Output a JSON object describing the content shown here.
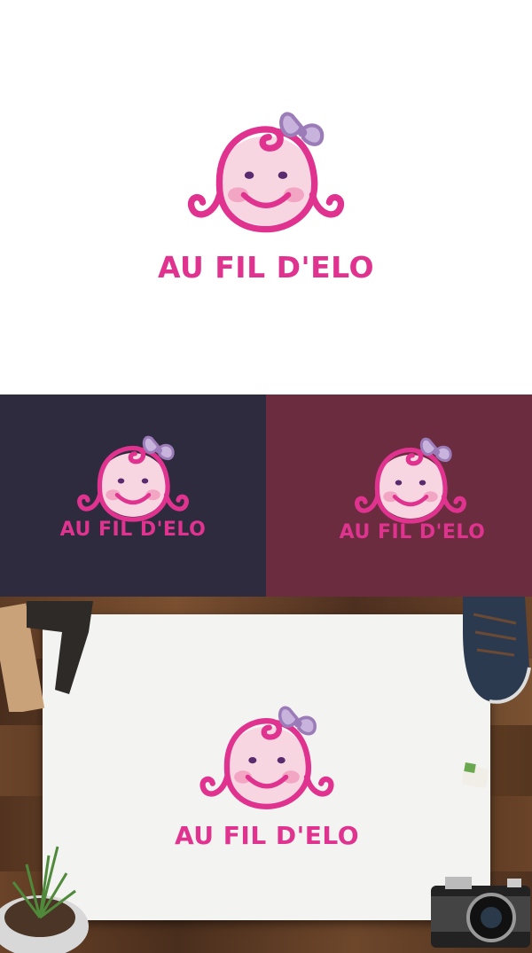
{
  "brand": {
    "name": "AU FIL D'ELO"
  },
  "colors": {
    "magenta": "#e0338f",
    "light_magenta": "#f06aa8",
    "face": "#f7d6e2",
    "cheek": "#f3a6c4",
    "bow": "#9b7cb8",
    "bow_light": "#c8b3dc",
    "eye": "#5a2a6e",
    "dark_panel": "#2f2b3f",
    "plum_panel": "#6a2c3e",
    "paper": "#f3f3f1",
    "wood": "#5a3a26"
  },
  "panels": [
    {
      "name": "white-presentation",
      "background": "#ffffff"
    },
    {
      "name": "dark-navy-presentation",
      "background": "#2f2b3f"
    },
    {
      "name": "plum-presentation",
      "background": "#6a2c3e"
    },
    {
      "name": "paper-mockup-on-wood",
      "background": "#5a3a26"
    }
  ]
}
